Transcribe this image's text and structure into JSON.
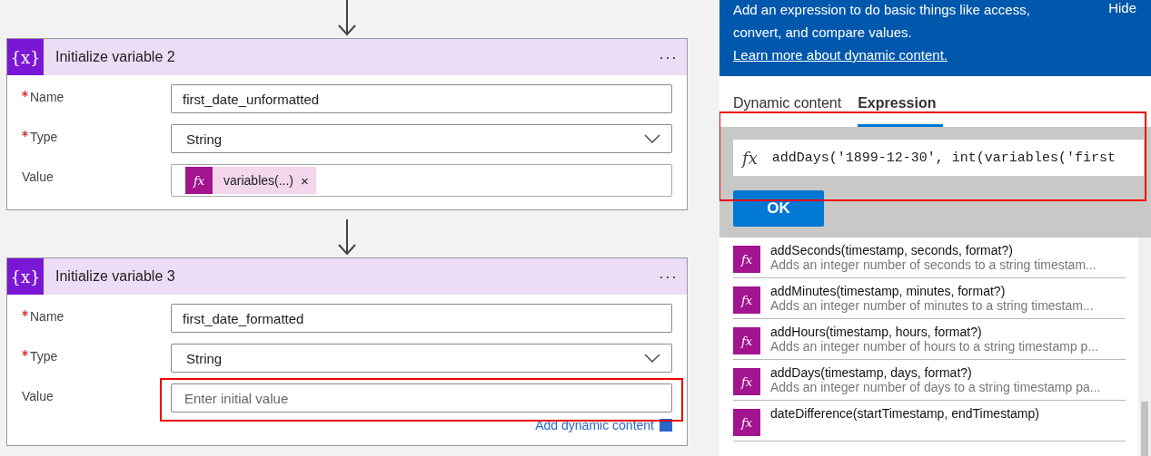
{
  "canvas": {
    "cards": [
      {
        "icon": "{x}",
        "title": "Initialize variable 2",
        "menu": "···",
        "fields": [
          {
            "label": "Name",
            "required": true,
            "kind": "text",
            "value": "first_date_unformatted"
          },
          {
            "label": "Type",
            "required": true,
            "kind": "dropdown",
            "value": "String"
          },
          {
            "label": "Value",
            "required": false,
            "kind": "token",
            "icon": "fx",
            "token": "variables(...)",
            "remove": "×"
          }
        ]
      },
      {
        "icon": "{x}",
        "title": "Initialize variable 3",
        "menu": "···",
        "fields": [
          {
            "label": "Name",
            "required": true,
            "kind": "text",
            "value": "first_date_formatted"
          },
          {
            "label": "Type",
            "required": true,
            "kind": "dropdown",
            "value": "String"
          },
          {
            "label": "Value",
            "required": false,
            "kind": "input",
            "placeholder": "Enter initial value",
            "highlighted": true,
            "link": "Add dynamic content"
          }
        ]
      }
    ]
  },
  "panel": {
    "intro": "Add an expression to do basic things like access, convert, and compare values.",
    "intro_link": "Learn more about dynamic content.",
    "hide": "Hide",
    "tabs": [
      {
        "label": "Dynamic content",
        "selected": false
      },
      {
        "label": "Expression",
        "selected": true
      }
    ],
    "expression": {
      "icon": "fx",
      "value": "addDays('1899-12-30', int(variables('first",
      "highlighted": true
    },
    "ok": "OK",
    "functions": [
      {
        "icon": "fx",
        "name": "addSeconds(timestamp, seconds, format?)",
        "description": "Adds an integer number of seconds to a string timestam..."
      },
      {
        "icon": "fx",
        "name": "addMinutes(timestamp, minutes, format?)",
        "description": "Adds an integer number of minutes to a string timestam..."
      },
      {
        "icon": "fx",
        "name": "addHours(timestamp, hours, format?)",
        "description": "Adds an integer number of hours to a string timestamp p..."
      },
      {
        "icon": "fx",
        "name": "addDays(timestamp, days, format?)",
        "description": "Adds an integer number of days to a string timestamp pa..."
      },
      {
        "icon": "fx",
        "name": "dateDifference(startTimestamp, endTimestamp)"
      }
    ]
  }
}
